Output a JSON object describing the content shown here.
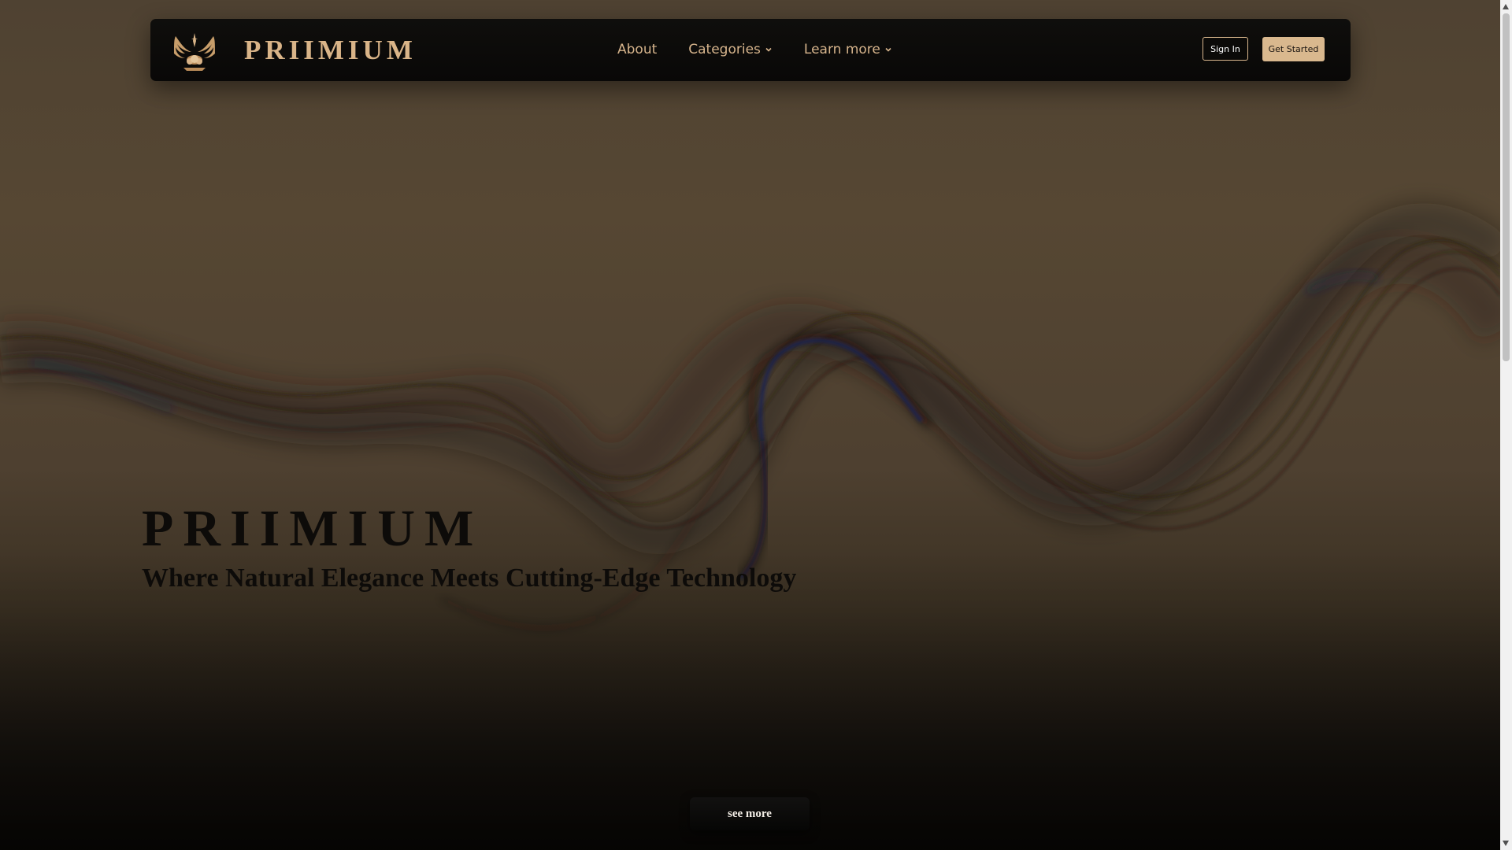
{
  "brand": {
    "name": "PRIIMIUM",
    "logo_icon": "winged-emblem-icon",
    "accent_color": "#d9b488"
  },
  "nav": {
    "about": "About",
    "categories": "Categories",
    "learn_more": "Learn more",
    "dropdown_icon": "chevron-down-icon"
  },
  "auth": {
    "sign_in": "Sign In",
    "get_started": "Get Started"
  },
  "hero": {
    "title": "PRIIMIUM",
    "subtitle": "Where Natural Elegance Meets Cutting-Edge Technology",
    "cta": "see more"
  },
  "colors": {
    "background_top": "#4f4232",
    "background_bottom": "#0c0a07",
    "wave_highlight": "#1a2550"
  }
}
